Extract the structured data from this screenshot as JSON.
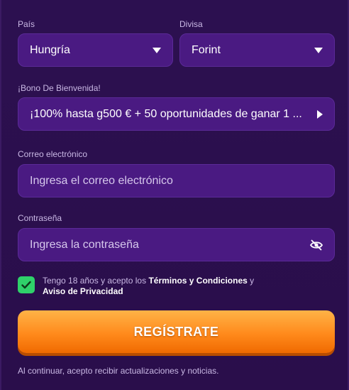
{
  "country": {
    "label": "País",
    "value": "Hungría"
  },
  "currency": {
    "label": "Divisa",
    "value": "Forint"
  },
  "bonus": {
    "label": "¡Bono De Bienvenida!",
    "value": "¡100% hasta g500 € + 50 oportunidades de ganar 1 ..."
  },
  "email": {
    "label": "Correo electrónico",
    "placeholder": "Ingresa el correo electrónico"
  },
  "password": {
    "label": "Contraseña",
    "placeholder": "Ingresa la contraseña"
  },
  "terms": {
    "part1": "Tengo 18 años y acepto los ",
    "terms_link": "Términos y Condiciones",
    "part2": " y ",
    "privacy_link": "Aviso de Privacidad",
    "checked": true
  },
  "cta": {
    "label": "REGÍSTRATE"
  },
  "footer": {
    "text": "Al continuar, acepto recibir actualizaciones y noticias."
  },
  "colors": {
    "field_bg": "#4a1a82",
    "page_bg": "#2a0f4a",
    "check_green": "#2fd16a",
    "cta_orange": "#ff8a1c"
  }
}
